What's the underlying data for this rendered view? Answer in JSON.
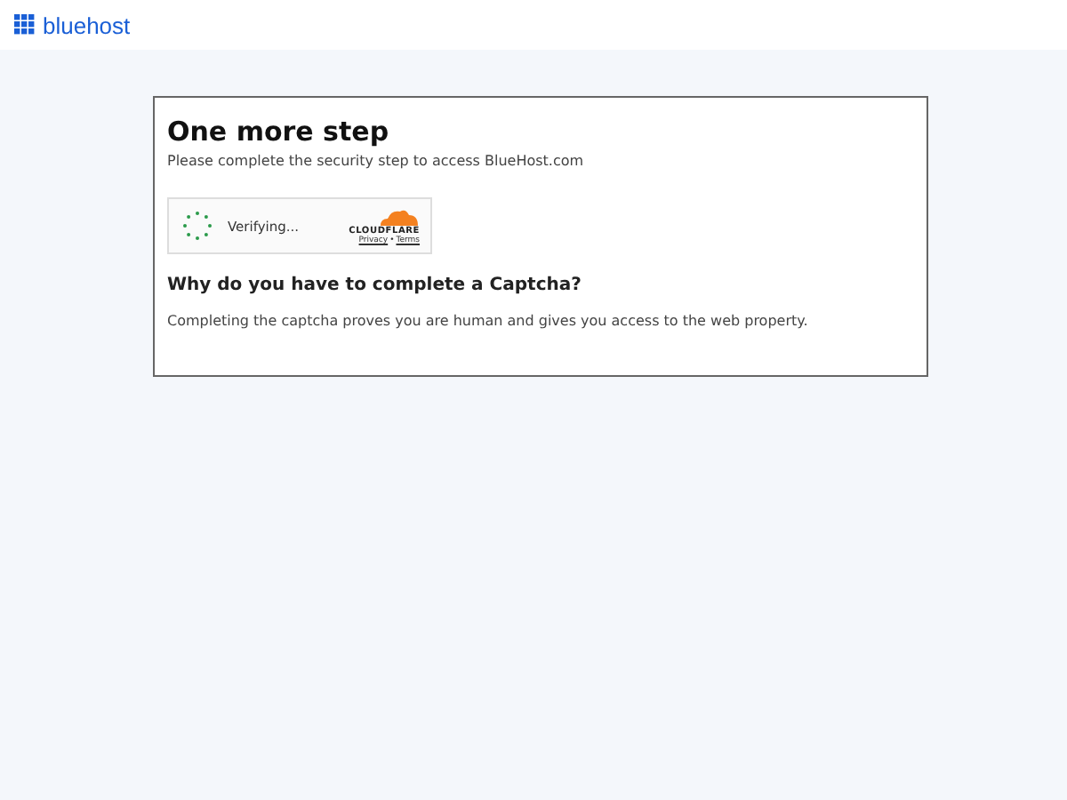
{
  "header": {
    "logo_text": "bluehost"
  },
  "card": {
    "title": "One more step",
    "subtitle": "Please complete the security step to access BlueHost.com",
    "widget": {
      "status": "Verifying...",
      "brand": "CLOUDFLARE",
      "links": [
        {
          "label": "Privacy"
        },
        {
          "label": "Terms"
        }
      ],
      "separator": "•"
    },
    "heading": "Why do you have to complete a Captcha?",
    "text": "Completing the captcha proves you are human and gives you access to the web property."
  }
}
